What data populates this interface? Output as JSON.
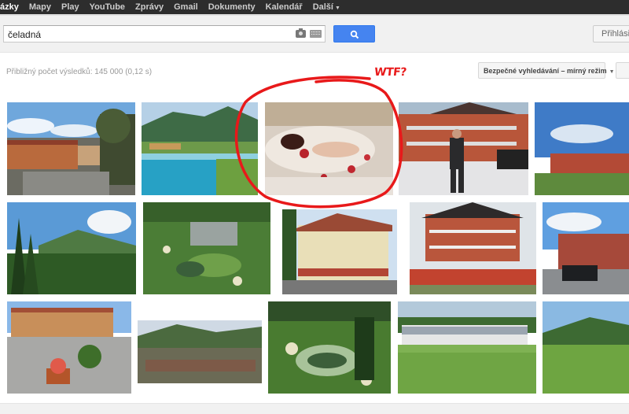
{
  "nav": {
    "items": [
      {
        "label": "ázky",
        "active": true
      },
      {
        "label": "Mapy"
      },
      {
        "label": "Play"
      },
      {
        "label": "YouTube"
      },
      {
        "label": "Zprávy"
      },
      {
        "label": "Gmail"
      },
      {
        "label": "Dokumenty"
      },
      {
        "label": "Kalendář"
      },
      {
        "label": "Další",
        "dropdown": true
      }
    ]
  },
  "search": {
    "query": "čeladná",
    "camera_icon": "camera-icon",
    "keyboard_icon": "keyboard-icon",
    "button_icon": "search-icon"
  },
  "header": {
    "signin_label": "Přihlásit"
  },
  "results": {
    "count_text": "Přibližný počet výsledků: 145 000 (0,12 s)",
    "safesearch_label": "Bezpečné vyhledávání – mírný režim"
  },
  "annotation": {
    "text": "WTF?",
    "color": "#e8191a"
  },
  "colors": {
    "topbar": "#2d2d2d",
    "search_button": "#4584f0",
    "header_bg": "#f1f1f1"
  },
  "images": [
    {
      "name": "image-result-hotel-town"
    },
    {
      "name": "image-result-lake-resort"
    },
    {
      "name": "image-result-bloody-bed"
    },
    {
      "name": "image-result-man-in-suit"
    },
    {
      "name": "image-result-red-building"
    },
    {
      "name": "image-result-forest-hill"
    },
    {
      "name": "image-result-golf-aerial"
    },
    {
      "name": "image-result-spa-house"
    },
    {
      "name": "image-result-apartment-fence"
    },
    {
      "name": "image-result-hotel-cars"
    },
    {
      "name": "image-result-square-crowd"
    },
    {
      "name": "image-result-village-valley"
    },
    {
      "name": "image-result-golf-pond"
    },
    {
      "name": "image-result-golf-stand"
    },
    {
      "name": "image-result-green-slope"
    }
  ]
}
